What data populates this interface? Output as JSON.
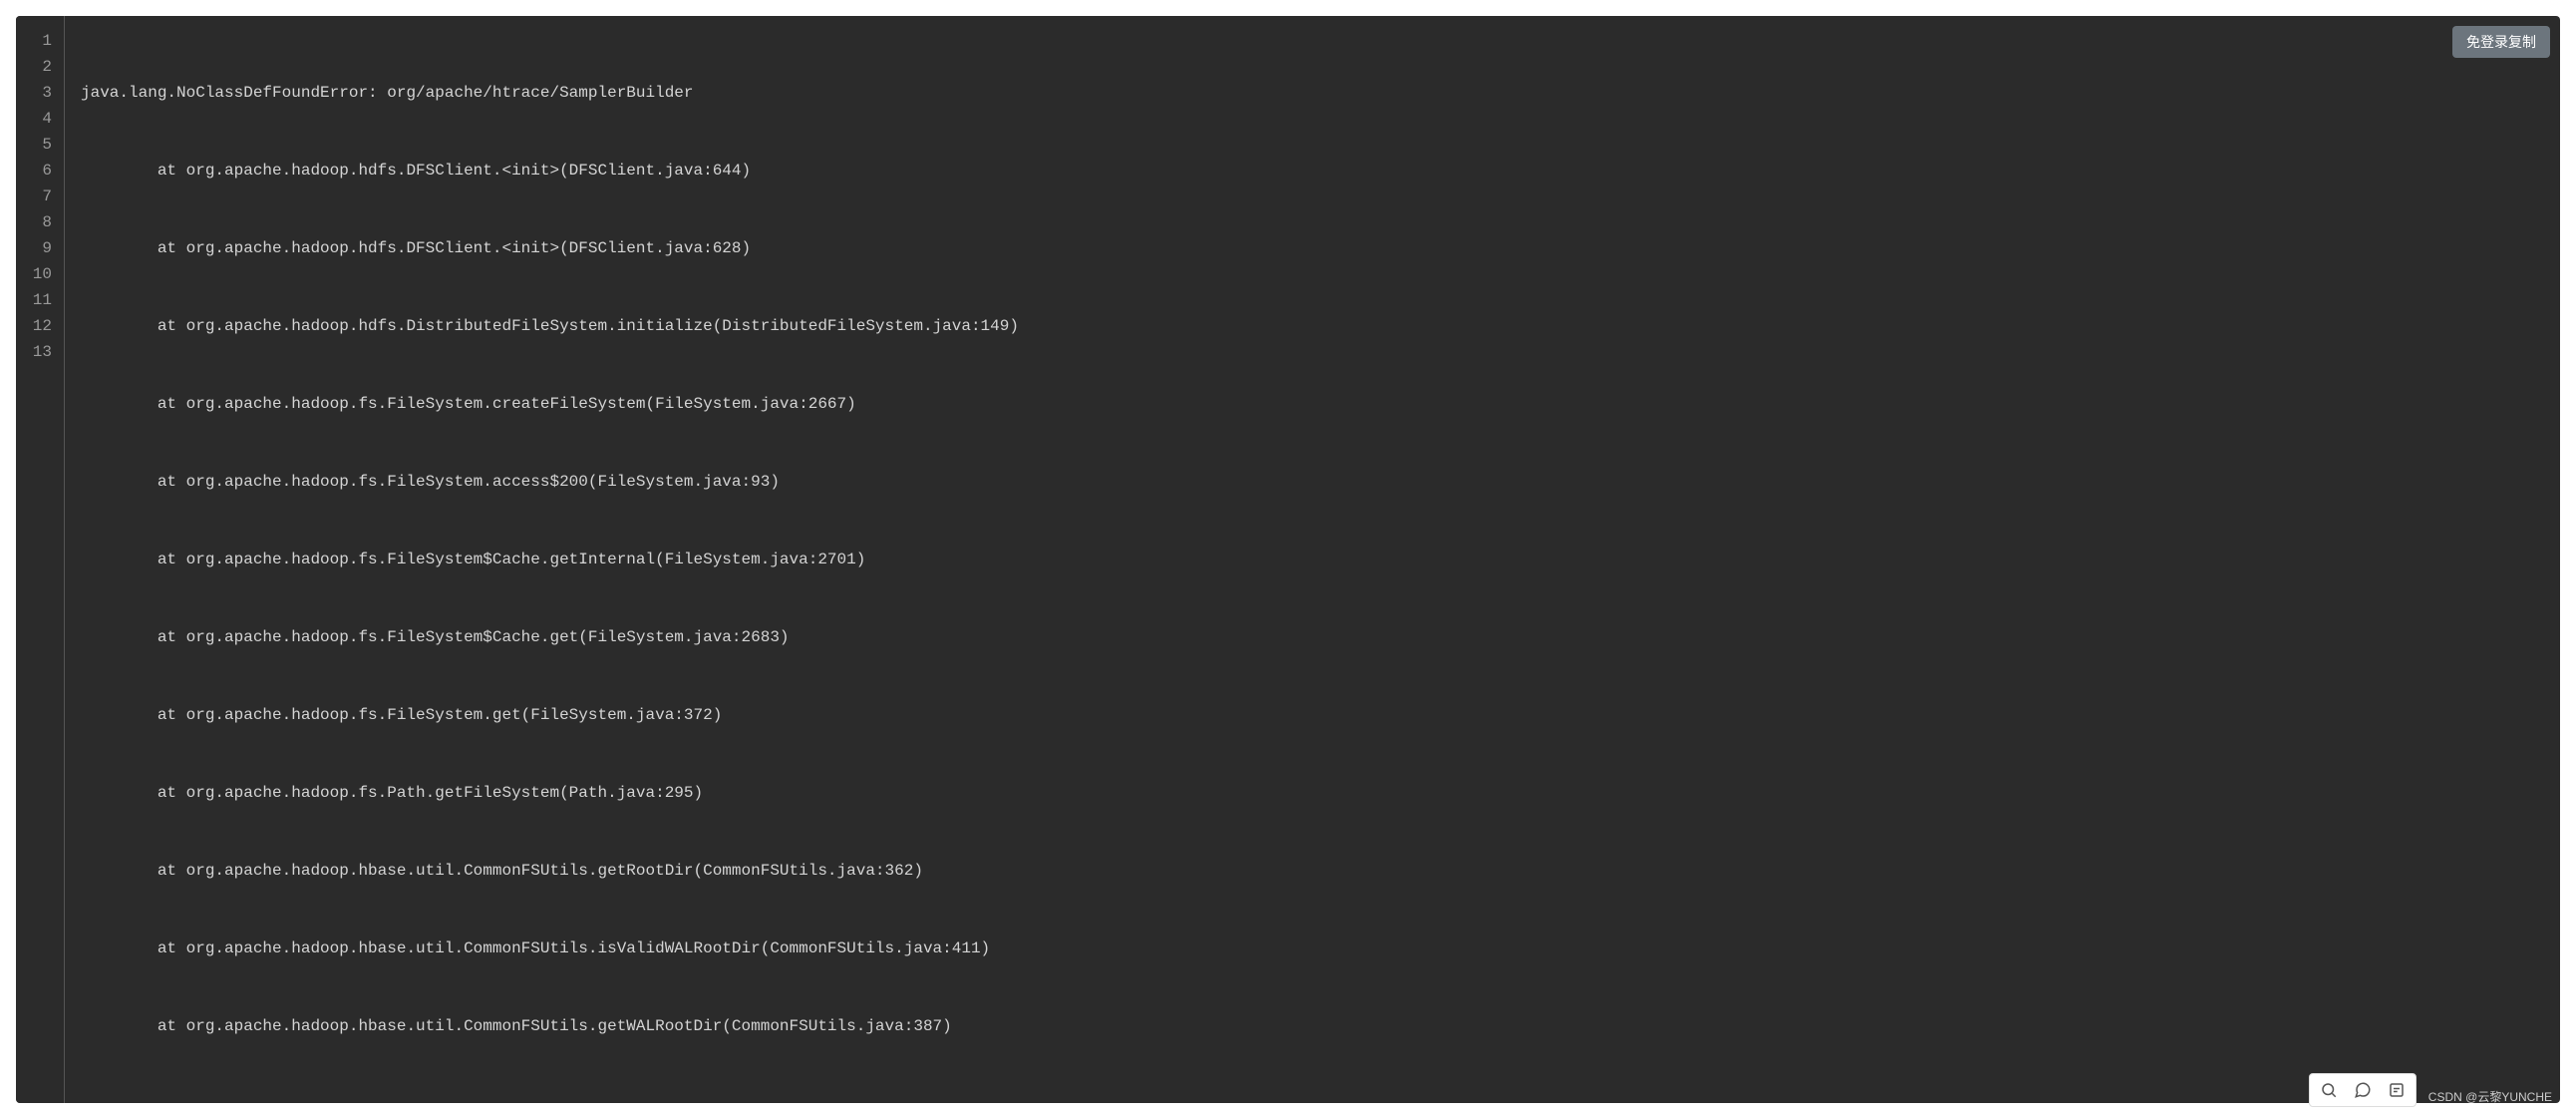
{
  "copy_button_label": "免登录复制",
  "watermark": "CSDN @云黎YUNCHE",
  "code": {
    "lines": [
      "java.lang.NoClassDefFoundError: org/apache/htrace/SamplerBuilder",
      "        at org.apache.hadoop.hdfs.DFSClient.<init>(DFSClient.java:644)",
      "        at org.apache.hadoop.hdfs.DFSClient.<init>(DFSClient.java:628)",
      "        at org.apache.hadoop.hdfs.DistributedFileSystem.initialize(DistributedFileSystem.java:149)",
      "        at org.apache.hadoop.fs.FileSystem.createFileSystem(FileSystem.java:2667)",
      "        at org.apache.hadoop.fs.FileSystem.access$200(FileSystem.java:93)",
      "        at org.apache.hadoop.fs.FileSystem$Cache.getInternal(FileSystem.java:2701)",
      "        at org.apache.hadoop.fs.FileSystem$Cache.get(FileSystem.java:2683)",
      "        at org.apache.hadoop.fs.FileSystem.get(FileSystem.java:372)",
      "        at org.apache.hadoop.fs.Path.getFileSystem(Path.java:295)",
      "        at org.apache.hadoop.hbase.util.CommonFSUtils.getRootDir(CommonFSUtils.java:362)",
      "        at org.apache.hadoop.hbase.util.CommonFSUtils.isValidWALRootDir(CommonFSUtils.java:411)",
      "        at org.apache.hadoop.hbase.util.CommonFSUtils.getWALRootDir(CommonFSUtils.java:387)"
    ],
    "line_count": 13
  }
}
